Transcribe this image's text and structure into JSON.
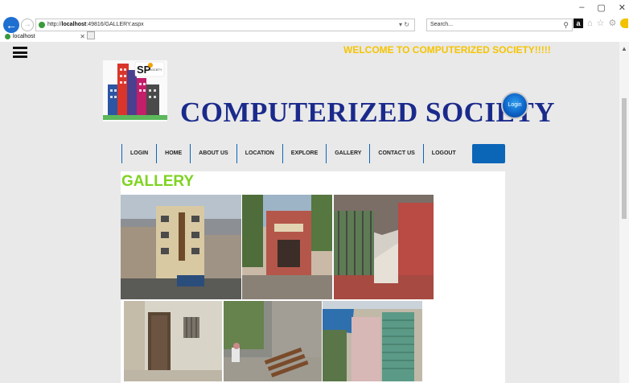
{
  "browser": {
    "url_prefix": "http://",
    "url_host": "localhost",
    "url_rest": ":49816/GALLERY.aspx",
    "search_placeholder": "Search...",
    "tab_title": "localhost",
    "window_controls": [
      "–",
      "▢",
      "✕"
    ]
  },
  "page": {
    "welcome_text": "WELCOME TO COMPUTERIZED SOCIETY!!!!!",
    "site_title": "COMPUTERIZED SOCIETY",
    "login_label": "Login",
    "menu": [
      "LOGIN",
      "HOME",
      "ABOUT US",
      "LOCATION",
      "EXPLORE",
      "GALLERY",
      "CONTACT US",
      "LOGOUT"
    ],
    "gallery_title": "GALLERY",
    "logo_text": "SOCIETY"
  },
  "colors": {
    "welcome": "#f5c400",
    "title": "#1a2a8c",
    "menu_accent": "#0b66b8",
    "gallery_heading": "#7ed321"
  }
}
